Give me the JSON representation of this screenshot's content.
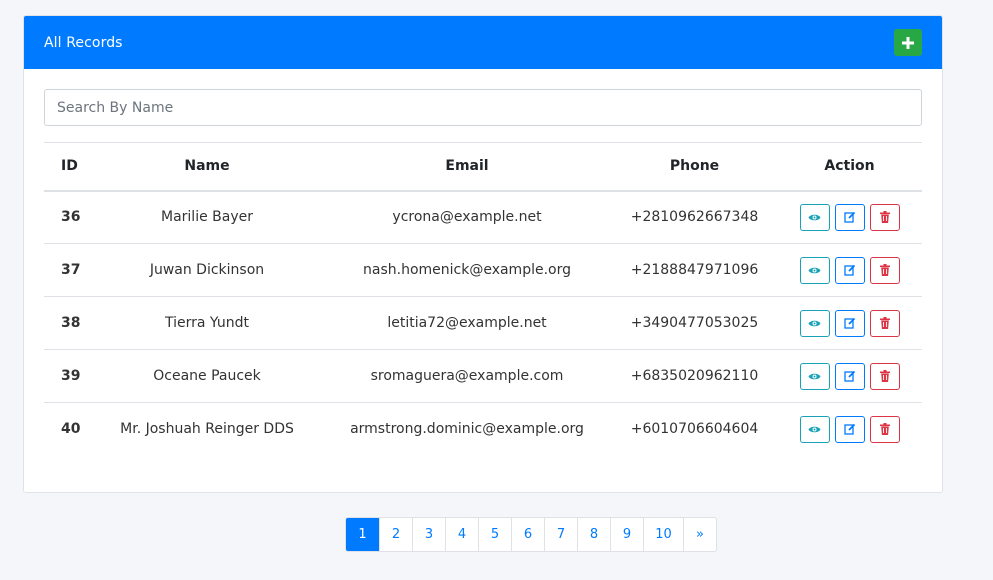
{
  "card": {
    "title": "All Records"
  },
  "search": {
    "placeholder": "Search By Name",
    "value": ""
  },
  "table": {
    "headers": {
      "id": "ID",
      "name": "Name",
      "email": "Email",
      "phone": "Phone",
      "action": "Action"
    },
    "rows": [
      {
        "id": "36",
        "name": "Marilie Bayer",
        "email": "ycrona@example.net",
        "phone": "+2810962667348"
      },
      {
        "id": "37",
        "name": "Juwan Dickinson",
        "email": "nash.homenick@example.org",
        "phone": "+2188847971096"
      },
      {
        "id": "38",
        "name": "Tierra Yundt",
        "email": "letitia72@example.net",
        "phone": "+3490477053025"
      },
      {
        "id": "39",
        "name": "Oceane Paucek",
        "email": "sromaguera@example.com",
        "phone": "+6835020962110"
      },
      {
        "id": "40",
        "name": "Mr. Joshuah Reinger DDS",
        "email": "armstrong.dominic@example.org",
        "phone": "+6010706604604"
      }
    ]
  },
  "pagination": {
    "pages": [
      "1",
      "2",
      "3",
      "4",
      "5",
      "6",
      "7",
      "8",
      "9",
      "10"
    ],
    "active": "1",
    "next": "»"
  },
  "colors": {
    "header": "#007bff",
    "add": "#28a745",
    "view": "#17a2b8",
    "edit": "#007bff",
    "delete": "#dc3545"
  },
  "icons": {
    "add": "plus-icon",
    "view": "eye-icon",
    "edit": "edit-icon",
    "delete": "trash-icon"
  }
}
